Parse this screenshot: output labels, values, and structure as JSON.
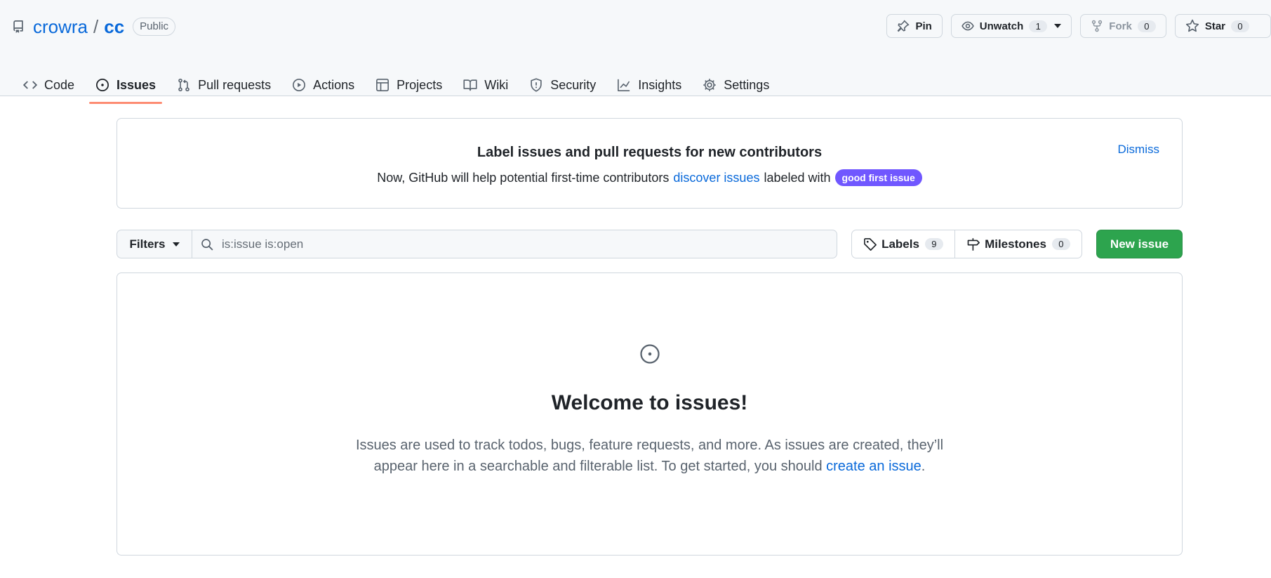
{
  "repo": {
    "owner": "crowra",
    "separator": "/",
    "name": "cc",
    "visibility": "Public"
  },
  "header_actions": {
    "pin_label": "Pin",
    "unwatch_label": "Unwatch",
    "watch_count": "1",
    "fork_label": "Fork",
    "fork_count": "0",
    "star_label": "Star",
    "star_count": "0"
  },
  "tabs": [
    {
      "label": "Code",
      "icon": "code-icon"
    },
    {
      "label": "Issues",
      "icon": "issue-opened-icon",
      "active": true
    },
    {
      "label": "Pull requests",
      "icon": "git-pull-request-icon"
    },
    {
      "label": "Actions",
      "icon": "play-icon"
    },
    {
      "label": "Projects",
      "icon": "table-icon"
    },
    {
      "label": "Wiki",
      "icon": "book-icon"
    },
    {
      "label": "Security",
      "icon": "shield-icon"
    },
    {
      "label": "Insights",
      "icon": "graph-icon"
    },
    {
      "label": "Settings",
      "icon": "gear-icon"
    }
  ],
  "banner": {
    "title": "Label issues and pull requests for new contributors",
    "text_before": "Now, GitHub will help potential first-time contributors",
    "link": "discover issues",
    "text_after": "labeled with",
    "label": "good first issue",
    "label_color": "#7057ff",
    "dismiss": "Dismiss"
  },
  "toolbar": {
    "filters_label": "Filters",
    "search_value": "is:issue is:open",
    "labels_label": "Labels",
    "labels_count": "9",
    "milestones_label": "Milestones",
    "milestones_count": "0",
    "new_issue_label": "New issue"
  },
  "blankslate": {
    "title": "Welcome to issues!",
    "text_line1": "Issues are used to track todos, bugs, feature requests, and more. As issues are created, they’ll",
    "text_line2_before": "appear here in a searchable and filterable list. To get started, you should",
    "link": "create an issue",
    "text_line2_after": "."
  },
  "colors": {
    "link": "#0969da",
    "primary_button": "#2da44e",
    "active_tab_underline": "#fd8c73"
  }
}
